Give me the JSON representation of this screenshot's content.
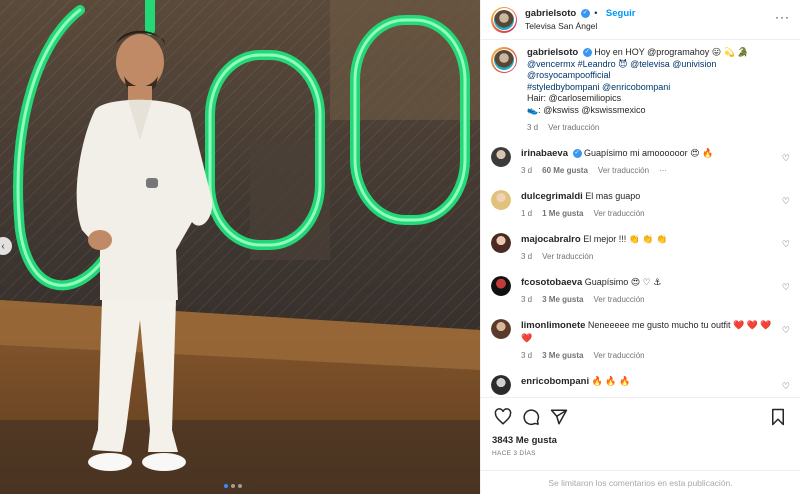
{
  "header": {
    "username": "gabrielsoto",
    "follow_label": "Seguir",
    "location": "Televisa San Ángel",
    "separator": "•"
  },
  "caption": {
    "username": "gabrielsoto",
    "lines": [
      "Hoy en HOY @programahoy 😛 💫 🐊",
      "@vencermx #Leandro 😈 @televisa @univision",
      "@rosyocampoofficial",
      "#styledbybompani @enricobompani",
      "Hair: @carlosemiliopics",
      "👟: @kswiss @kswissmexico"
    ],
    "time": "3 d",
    "translate": "Ver traducción"
  },
  "comments": [
    {
      "username": "irinabaeva",
      "verified": true,
      "text": "Guapísimo mi amoooooor 😍 🔥",
      "time": "3 d",
      "likes": "60 Me gusta",
      "translate": "Ver traducción",
      "more": "···"
    },
    {
      "username": "dulcegrimaldi",
      "verified": false,
      "text": "El mas guapo",
      "time": "1 d",
      "likes": "1 Me gusta",
      "translate": "Ver traducción"
    },
    {
      "username": "majocabralro",
      "verified": false,
      "text": "El mejor !!! 👏 👏 👏",
      "time": "3 d",
      "likes": "",
      "translate": "Ver traducción"
    },
    {
      "username": "fcosotobaeva",
      "verified": false,
      "text": "Guapísimo 😍 ♡ ⚓",
      "time": "3 d",
      "likes": "3 Me gusta",
      "translate": "Ver traducción"
    },
    {
      "username": "limonlimonete",
      "verified": false,
      "text": "Neneeeee me gusto mucho tu outfit ❤️ ❤️ ❤️ ❤️",
      "time": "3 d",
      "likes": "3 Me gusta",
      "translate": "Ver traducción"
    },
    {
      "username": "enricobompani",
      "verified": false,
      "text": "🔥 🔥 🔥",
      "time": "",
      "likes": "",
      "translate": ""
    }
  ],
  "post": {
    "likes": "3843 Me gusta",
    "ago": "HACE 3 DÍAS",
    "comments_disabled": "Se limitaron los comentarios en esta publicación."
  },
  "icons": {
    "like": "heart-icon",
    "comment": "comment-icon",
    "share": "share-icon",
    "save": "bookmark-icon",
    "more": "more-icon",
    "prev": "chevron-left-icon"
  },
  "colors": {
    "link": "#0095f6",
    "tag": "#00376b",
    "muted": "#737373",
    "neon": "#22e07a"
  }
}
